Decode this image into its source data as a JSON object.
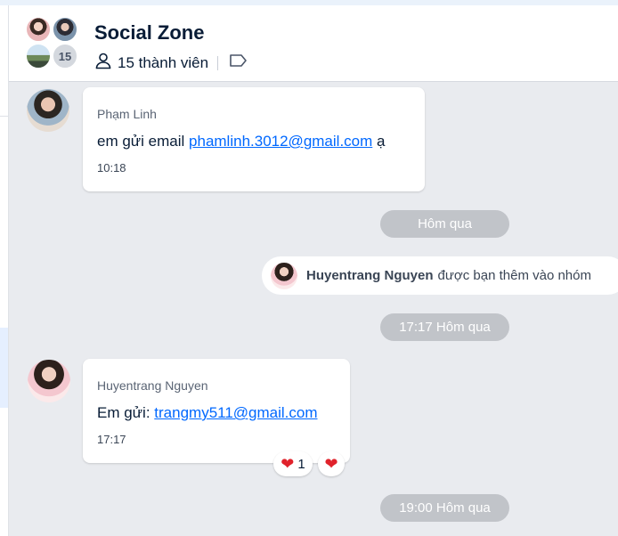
{
  "header": {
    "title": "Social Zone",
    "avatar_extra_count": "15",
    "member_count_label": "15 thành viên"
  },
  "messages": [
    {
      "sender": "Phạm Linh",
      "text_prefix": "em gửi email ",
      "email": "phamlinh.3012@gmail.com",
      "text_suffix": " ạ",
      "time": "10:18"
    },
    {
      "sender": "Huyentrang Nguyen",
      "text_prefix": "Em gửi: ",
      "email": "trangmy511@gmail.com",
      "time": "17:17",
      "reaction_count": "1",
      "reaction_icon": "heart-icon"
    }
  ],
  "separators": {
    "first": "Hôm qua",
    "second": "17:17 Hôm qua",
    "third": "19:00 Hôm qua"
  },
  "system_notice": {
    "name": "Huyentrang Nguyen",
    "text": "được bạn thêm vào nhóm"
  },
  "colors": {
    "link": "#0068ff",
    "chat_background": "#e9ebef",
    "separator_pill": "#c1c4c9",
    "heart": "#e0222b"
  }
}
